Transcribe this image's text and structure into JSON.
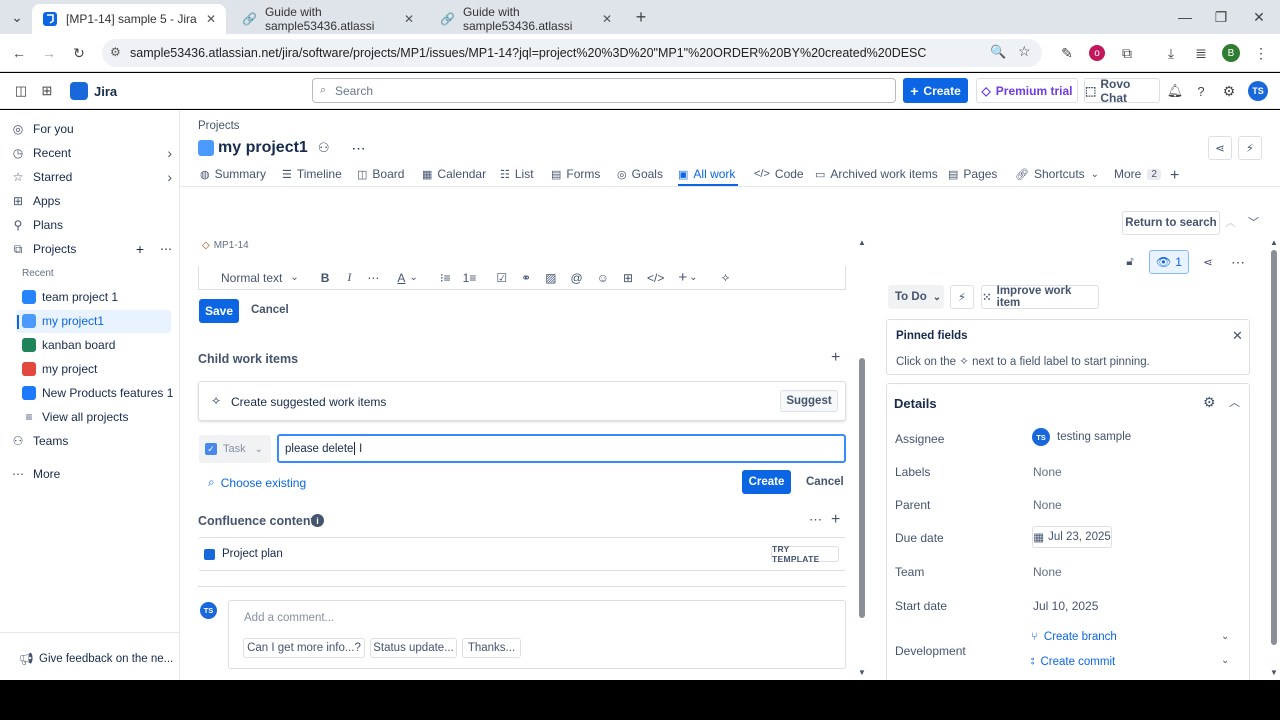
{
  "browser": {
    "tabs": [
      {
        "title": "[MP1-14] sample 5 - Jira",
        "active": true
      },
      {
        "title": "Guide with sample53436.atlassi",
        "active": false
      },
      {
        "title": "Guide with sample53436.atlassi",
        "active": false
      }
    ],
    "url": "sample53436.atlassian.net/jira/software/projects/MP1/issues/MP1-14?jql=project%20%3D%20\"MP1\"%20ORDER%20BY%20created%20DESC",
    "profile_initial": "B"
  },
  "topbar": {
    "logo": "Jira",
    "search_placeholder": "Search",
    "create": "Create",
    "premium": "Premium trial",
    "rovo": "Rovo Chat",
    "avatar": "TS"
  },
  "sidebar": {
    "items": [
      {
        "label": "For you"
      },
      {
        "label": "Recent"
      },
      {
        "label": "Starred"
      },
      {
        "label": "Apps"
      },
      {
        "label": "Plans"
      },
      {
        "label": "Projects"
      }
    ],
    "recent_heading": "Recent",
    "projects": [
      {
        "label": "team project 1",
        "color": "#2684ff"
      },
      {
        "label": "my project1",
        "color": "#4c9aff"
      },
      {
        "label": "kanban board",
        "color": "#1f845a"
      },
      {
        "label": "my project",
        "color": "#e2483d"
      },
      {
        "label": "New Products features 1",
        "color": "#1d7afc"
      }
    ],
    "view_all": "View all projects",
    "teams": "Teams",
    "more": "More",
    "feedback": "Give feedback on the ne..."
  },
  "project": {
    "breadcrumb": "Projects",
    "name": "my project1",
    "tabs": [
      "Summary",
      "Timeline",
      "Board",
      "Calendar",
      "List",
      "Forms",
      "Goals",
      "All work",
      "Code",
      "Archived work items",
      "Pages",
      "Shortcuts",
      "More"
    ],
    "more_count": "2"
  },
  "issue": {
    "key": "MP1-14",
    "return_to_search": "Return to search",
    "editor": {
      "style": "Normal text",
      "save": "Save",
      "cancel": "Cancel"
    },
    "child": {
      "heading": "Child work items",
      "suggest_text": "Create suggested work items",
      "suggest_btn": "Suggest",
      "type": "Task",
      "input_value": "please delete",
      "choose_existing": "Choose existing",
      "create": "Create",
      "cancel": "Cancel"
    },
    "confluence": {
      "heading": "Confluence content",
      "item": "Project plan",
      "template": "TRY TEMPLATE"
    },
    "comment": {
      "avatar": "TS",
      "placeholder": "Add a comment...",
      "suggestions": [
        "Can I get more info...?",
        "Status update...",
        "Thanks..."
      ]
    }
  },
  "right": {
    "watch_count": "1",
    "status": "To Do",
    "improve": "Improve work item",
    "pinned_title": "Pinned fields",
    "pinned_hint_1": "Click on the",
    "pinned_hint_2": "next to a field label to start pinning.",
    "details": "Details",
    "fields": {
      "assignee_label": "Assignee",
      "assignee": "testing sample",
      "assignee_avatar": "TS",
      "labels_label": "Labels",
      "labels": "None",
      "parent_label": "Parent",
      "parent": "None",
      "due_label": "Due date",
      "due": "Jul 23, 2025",
      "team_label": "Team",
      "team": "None",
      "start_label": "Start date",
      "start": "Jul 10, 2025",
      "dev_label": "Development",
      "branch": "Create branch",
      "commit": "Create commit"
    }
  }
}
